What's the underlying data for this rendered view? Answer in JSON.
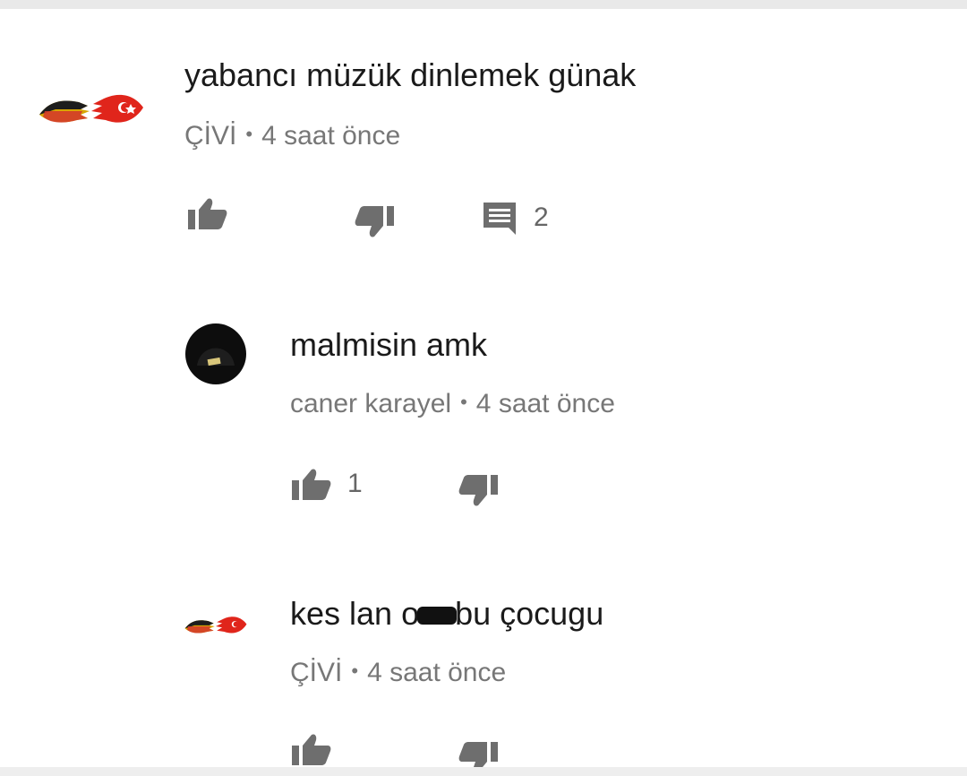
{
  "comments": [
    {
      "text": "yabancı müzük dinlemek günak",
      "author": "ÇİVİ",
      "time": "4 saat önce",
      "reply_count": "2"
    },
    {
      "text": "malmisin amk",
      "author": "caner karayel",
      "time": "4 saat önce",
      "like_count": "1"
    },
    {
      "text_before": "kes lan o",
      "text_after": "bu çocugu",
      "author": "ÇİVİ",
      "time": "4 saat önce"
    }
  ],
  "icons": {
    "like": "thumbs-up-icon",
    "dislike": "thumbs-down-icon",
    "reply": "reply-comment-icon"
  },
  "colors": {
    "text": "#1a1a1a",
    "meta": "#777777",
    "icon": "#6e6e6e"
  }
}
